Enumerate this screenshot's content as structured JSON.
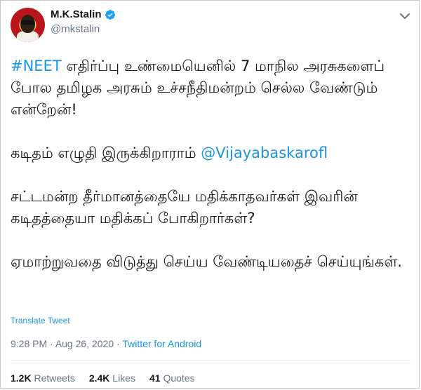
{
  "author": {
    "display_name": "M.K.Stalin",
    "handle": "@mkstalin",
    "verified_icon": "verified-badge-icon",
    "avatar": "avatar-image"
  },
  "tweet": {
    "p1_hashtag": "#NEET",
    "p1_text": " எதிர்ப்பு உண்மையெனில் 7 மாநில அரசுகளைப் போல தமிழக அரசும் உச்சநீதிமன்றம் செல்ல வேண்டும் என்றேன்!",
    "p2_text": "கடிதம் எழுதி இருக்கிறாராம் ",
    "p2_mention": "@Vijayabaskarofl",
    "p3_text": "சட்டமன்ற தீர்மானத்தையே மதிக்காதவர்கள் இவரின் கடிதத்தையா மதிக்கப் போகிறார்கள்?",
    "p4_text": "ஏமாற்றுவதை விடுத்து செய்ய வேண்டியதைச் செய்யுங்கள்.",
    "translate_label": "Translate Tweet"
  },
  "meta": {
    "time": "9:28 PM",
    "separator1": " · ",
    "date": "Aug 26, 2020",
    "separator2": " · ",
    "source": "Twitter for Android"
  },
  "stats": {
    "retweets_count": "1.2K",
    "retweets_label": " Retweets",
    "likes_count": "2.4K",
    "likes_label": " Likes",
    "quotes_count": "41",
    "quotes_label": " Quotes"
  },
  "colors": {
    "link": "#1b95e0",
    "secondary_text": "#657786",
    "primary_text": "#14171a"
  }
}
